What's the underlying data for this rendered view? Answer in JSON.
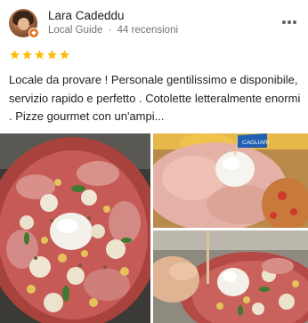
{
  "review": {
    "author": {
      "name": "Lara Cadeddu",
      "badge": "Local Guide",
      "separator": "·",
      "reviews_count": "44 recensioni"
    },
    "rating": 5,
    "max_rating": 5,
    "text": "Locale da provare ! Personale gentilissimo e disponibile, servizio rapido e perfetto . Cotolette letteralmente enormi . Pizze gourmet con un'ampi..."
  },
  "photos": [
    {
      "subject": "pizza-with-ham-burrata-potatoes"
    },
    {
      "subject": "cutlet-with-ham-burrata-and-flag",
      "flag_text": "CAGLIARI"
    },
    {
      "subject": "hand-holding-pizza-slice"
    }
  ],
  "colors": {
    "star": "#fbbc04",
    "meta_text": "#70757a",
    "badge": "#e8711a"
  },
  "icons": {
    "more": "more-vertical-dots-icon",
    "star": "star-icon",
    "badge": "local-guide-badge-icon"
  }
}
